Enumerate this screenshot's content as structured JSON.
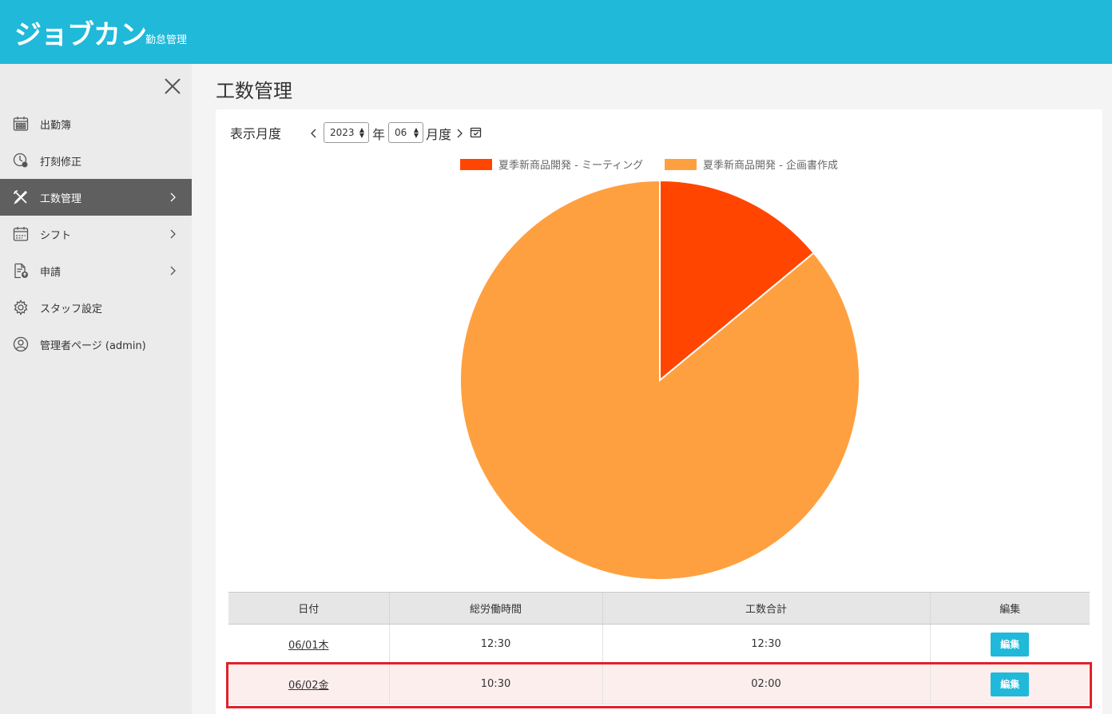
{
  "header": {
    "logo": "ジョブカン",
    "logo_sub": "勤怠管理"
  },
  "sidebar": {
    "items": [
      {
        "label": "出勤簿",
        "icon": "calendar-grid-icon",
        "active": false,
        "has_arrow": false
      },
      {
        "label": "打刻修正",
        "icon": "clock-edit-icon",
        "active": false,
        "has_arrow": false
      },
      {
        "label": "工数管理",
        "icon": "tools-icon",
        "active": true,
        "has_arrow": true
      },
      {
        "label": "シフト",
        "icon": "shift-calendar-icon",
        "active": false,
        "has_arrow": true
      },
      {
        "label": "申請",
        "icon": "document-upload-icon",
        "active": false,
        "has_arrow": true
      },
      {
        "label": "スタッフ設定",
        "icon": "gear-icon",
        "active": false,
        "has_arrow": false
      },
      {
        "label": "管理者ページ (admin)",
        "icon": "user-circle-icon",
        "active": false,
        "has_arrow": false
      }
    ]
  },
  "page": {
    "title": "工数管理"
  },
  "filter": {
    "label": "表示月度",
    "year": "2023",
    "year_unit": "年",
    "month": "06",
    "month_unit": "月度"
  },
  "chart_data": {
    "type": "pie",
    "labels": [
      "夏季新商品開発 - ミーティング",
      "夏季新商品開発 - 企画書作成"
    ],
    "values": [
      14,
      86
    ],
    "colors": [
      "#ff4500",
      "#ffa040"
    ],
    "legend": "top"
  },
  "table": {
    "headers": [
      "日付",
      "総労働時間",
      "工数合計",
      "編集"
    ],
    "rows": [
      {
        "date": "06/01木",
        "total": "12:30",
        "man_hours": "12:30",
        "edit": "編集",
        "highlighted": false
      },
      {
        "date": "06/02金",
        "total": "10:30",
        "man_hours": "02:00",
        "edit": "編集",
        "highlighted": true
      }
    ]
  }
}
